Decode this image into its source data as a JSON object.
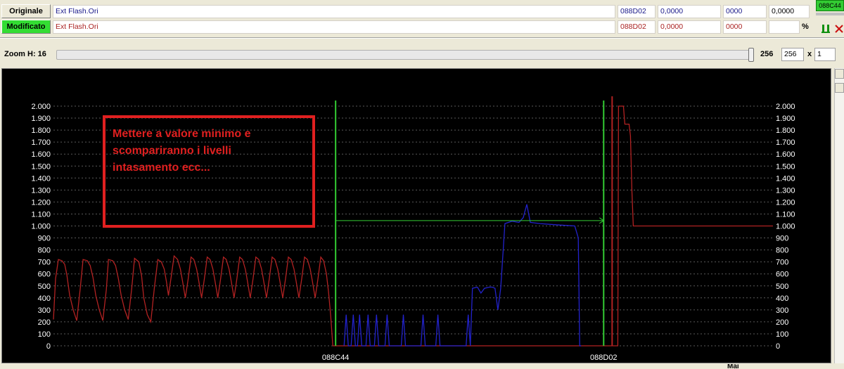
{
  "rows": {
    "originale": {
      "button_label": "Originale",
      "file_name": "Ext Flash.Ori",
      "address": "088D02",
      "value_a": "0,0000",
      "value_b": "0000",
      "value_c": "0,0000"
    },
    "modificato": {
      "button_label": "Modificato",
      "file_name": "Ext Flash.Ori",
      "address": "088D02",
      "value_a": "0,0000",
      "value_b": "0000",
      "percent_symbol": "%"
    }
  },
  "top_right_badge": "088C44",
  "zoom": {
    "label": "Zoom H: 16",
    "value_label": "256",
    "width_value": "256",
    "times": "x",
    "multiplier": "1"
  },
  "annotation": {
    "lines": [
      "Mettere a valore minimo e",
      "scompariranno i livelli",
      "intasamento ecc..."
    ]
  },
  "bottom_partial_text": "Mai",
  "colors": {
    "plot_background": "#000000",
    "grid": "#5a5a5a",
    "original_series": "#2222cc",
    "modified_series": "#b22222",
    "markers": "#33cc33",
    "annotation": "#e02020",
    "badge": "#33cc33"
  },
  "chart_data": {
    "type": "line",
    "yticks": [
      "0",
      "100",
      "200",
      "300",
      "400",
      "500",
      "600",
      "700",
      "800",
      "900",
      "1.000",
      "1.100",
      "1.200",
      "1.300",
      "1.400",
      "1.500",
      "1.600",
      "1.700",
      "1.800",
      "1.900",
      "2.000"
    ],
    "ylim": [
      0,
      2000
    ],
    "xlim": [
      0,
      1020
    ],
    "grid": true,
    "x_labels": [
      {
        "x": 400,
        "label": "088C44"
      },
      {
        "x": 780,
        "label": "088D02"
      }
    ],
    "markers": [
      {
        "x": 400,
        "label": "088C44",
        "color": "#33cc33"
      },
      {
        "x": 780,
        "label": "088D02",
        "color": "#33cc33"
      }
    ],
    "cursor_x": 792,
    "reference_line": {
      "y": 1045,
      "x": [
        400,
        780
      ]
    },
    "series": [
      {
        "color": "#b22222",
        "points": [
          [
            0,
            220
          ],
          [
            3,
            560
          ],
          [
            7,
            720
          ],
          [
            12,
            710
          ],
          [
            16,
            680
          ],
          [
            19,
            590
          ],
          [
            23,
            420
          ],
          [
            28,
            300
          ],
          [
            33,
            210
          ],
          [
            38,
            480
          ],
          [
            42,
            720
          ],
          [
            48,
            710
          ],
          [
            52,
            670
          ],
          [
            56,
            570
          ],
          [
            60,
            420
          ],
          [
            65,
            300
          ],
          [
            70,
            210
          ],
          [
            75,
            470
          ],
          [
            78,
            720
          ],
          [
            84,
            710
          ],
          [
            88,
            670
          ],
          [
            92,
            560
          ],
          [
            96,
            420
          ],
          [
            101,
            300
          ],
          [
            106,
            220
          ],
          [
            111,
            480
          ],
          [
            115,
            730
          ],
          [
            121,
            700
          ],
          [
            125,
            580
          ],
          [
            128,
            400
          ],
          [
            133,
            260
          ],
          [
            138,
            200
          ],
          [
            143,
            480
          ],
          [
            148,
            720
          ],
          [
            153,
            700
          ],
          [
            157,
            640
          ],
          [
            160,
            540
          ],
          [
            163,
            420
          ],
          [
            167,
            580
          ],
          [
            171,
            750
          ],
          [
            176,
            720
          ],
          [
            180,
            640
          ],
          [
            183,
            540
          ],
          [
            187,
            400
          ],
          [
            191,
            560
          ],
          [
            195,
            740
          ],
          [
            199,
            720
          ],
          [
            203,
            640
          ],
          [
            206,
            540
          ],
          [
            210,
            400
          ],
          [
            214,
            560
          ],
          [
            218,
            740
          ],
          [
            222,
            720
          ],
          [
            226,
            640
          ],
          [
            229,
            540
          ],
          [
            233,
            400
          ],
          [
            237,
            560
          ],
          [
            241,
            740
          ],
          [
            245,
            720
          ],
          [
            249,
            640
          ],
          [
            252,
            540
          ],
          [
            256,
            400
          ],
          [
            260,
            560
          ],
          [
            264,
            740
          ],
          [
            268,
            720
          ],
          [
            272,
            640
          ],
          [
            275,
            540
          ],
          [
            279,
            400
          ],
          [
            283,
            560
          ],
          [
            287,
            740
          ],
          [
            291,
            720
          ],
          [
            295,
            640
          ],
          [
            298,
            540
          ],
          [
            302,
            400
          ],
          [
            306,
            560
          ],
          [
            310,
            740
          ],
          [
            314,
            720
          ],
          [
            318,
            640
          ],
          [
            321,
            540
          ],
          [
            325,
            400
          ],
          [
            329,
            560
          ],
          [
            333,
            740
          ],
          [
            337,
            720
          ],
          [
            341,
            640
          ],
          [
            344,
            540
          ],
          [
            348,
            400
          ],
          [
            352,
            560
          ],
          [
            356,
            740
          ],
          [
            360,
            720
          ],
          [
            364,
            640
          ],
          [
            367,
            540
          ],
          [
            371,
            400
          ],
          [
            375,
            560
          ],
          [
            379,
            740
          ],
          [
            383,
            710
          ],
          [
            387,
            600
          ],
          [
            390,
            450
          ],
          [
            393,
            250
          ],
          [
            396,
            0
          ],
          [
            800,
            0
          ],
          [
            801,
            2000
          ],
          [
            808,
            2000
          ],
          [
            810,
            1850
          ],
          [
            816,
            1850
          ],
          [
            818,
            1750
          ],
          [
            820,
            1300
          ],
          [
            822,
            1000
          ],
          [
            1020,
            1000
          ]
        ]
      },
      {
        "color": "#2222cc",
        "points": [
          [
            412,
            0
          ],
          [
            415,
            260
          ],
          [
            418,
            0
          ],
          [
            422,
            0
          ],
          [
            425,
            260
          ],
          [
            428,
            0
          ],
          [
            431,
            0
          ],
          [
            434,
            260
          ],
          [
            437,
            0
          ],
          [
            443,
            0
          ],
          [
            446,
            260
          ],
          [
            449,
            0
          ],
          [
            455,
            0
          ],
          [
            458,
            260
          ],
          [
            461,
            0
          ],
          [
            470,
            0
          ],
          [
            473,
            260
          ],
          [
            476,
            0
          ],
          [
            493,
            0
          ],
          [
            496,
            260
          ],
          [
            499,
            0
          ],
          [
            521,
            0
          ],
          [
            524,
            260
          ],
          [
            527,
            0
          ],
          [
            542,
            0
          ],
          [
            545,
            260
          ],
          [
            548,
            0
          ],
          [
            585,
            0
          ],
          [
            588,
            260
          ],
          [
            591,
            0
          ],
          [
            594,
            480
          ],
          [
            601,
            490
          ],
          [
            606,
            440
          ],
          [
            611,
            480
          ],
          [
            618,
            490
          ],
          [
            622,
            490
          ],
          [
            626,
            480
          ],
          [
            630,
            300
          ],
          [
            634,
            480
          ],
          [
            640,
            1020
          ],
          [
            650,
            1040
          ],
          [
            660,
            1030
          ],
          [
            666,
            1070
          ],
          [
            671,
            1180
          ],
          [
            676,
            1030
          ],
          [
            690,
            1020
          ],
          [
            712,
            1010
          ],
          [
            739,
            1000
          ],
          [
            744,
            900
          ],
          [
            746,
            0
          ],
          [
            748,
            0
          ]
        ]
      }
    ]
  }
}
